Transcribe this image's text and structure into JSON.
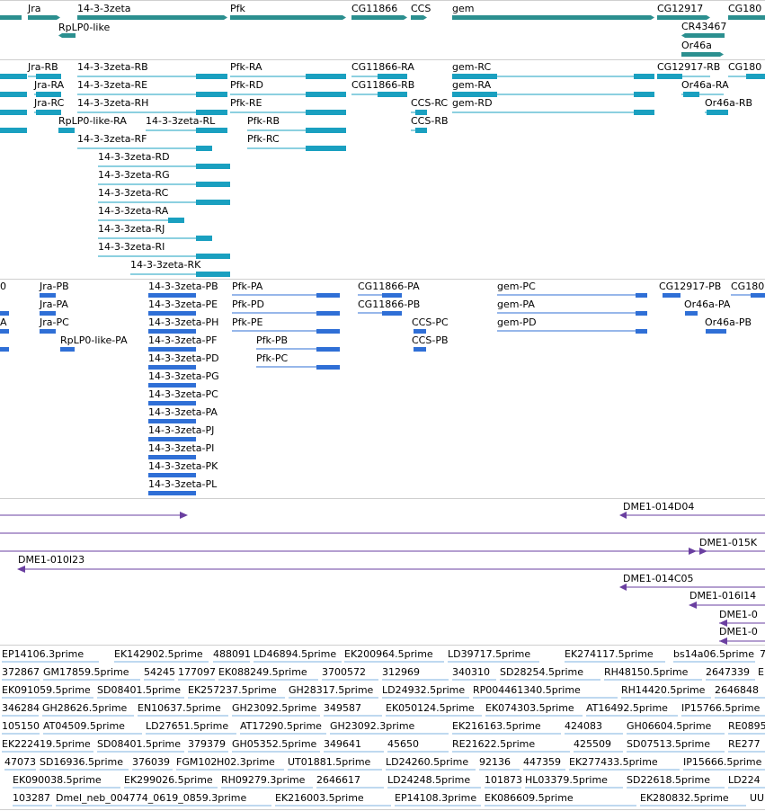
{
  "gene_track": {
    "color": "#2b8f8f",
    "labels": [
      "Jra",
      "14-3-3zeta",
      "Pfk",
      "CG11866",
      "CCS",
      "gem",
      "CG12917",
      "CG180",
      "RpLP0-like",
      "CR43467",
      "Or46a"
    ]
  },
  "transcript_track": {
    "color": "#1aa0c0",
    "labels": [
      "Jra-RB",
      "Jra-RA",
      "Jra-RC",
      "RpLP0-like-RA",
      "14-3-3zeta-RB",
      "14-3-3zeta-RE",
      "14-3-3zeta-RH",
      "14-3-3zeta-RL",
      "14-3-3zeta-RF",
      "14-3-3zeta-RD",
      "14-3-3zeta-RG",
      "14-3-3zeta-RC",
      "14-3-3zeta-RA",
      "14-3-3zeta-RJ",
      "14-3-3zeta-RI",
      "14-3-3zeta-RK",
      "Pfk-RA",
      "Pfk-RD",
      "Pfk-RE",
      "Pfk-RB",
      "Pfk-RC",
      "CG11866-RA",
      "CG11866-RB",
      "CCS-RC",
      "CCS-RB",
      "gem-RC",
      "gem-RA",
      "gem-RD",
      "CG12917-RB",
      "CG180",
      "Or46a-RA",
      "Or46a-RB"
    ]
  },
  "protein_track": {
    "color": "#2f6fd6",
    "labels": [
      "Jra-PB",
      "Jra-PA",
      "Jra-PC",
      "RpLP0-like-PA",
      "14-3-3zeta-PB",
      "14-3-3zeta-PE",
      "14-3-3zeta-PH",
      "14-3-3zeta-PF",
      "14-3-3zeta-PD",
      "14-3-3zeta-PG",
      "14-3-3zeta-PC",
      "14-3-3zeta-PA",
      "14-3-3zeta-PJ",
      "14-3-3zeta-PI",
      "14-3-3zeta-PK",
      "14-3-3zeta-PL",
      "Pfk-PA",
      "Pfk-PD",
      "Pfk-PE",
      "Pfk-PB",
      "Pfk-PC",
      "CG11866-PA",
      "CG11866-PB",
      "CCS-PC",
      "CCS-PB",
      "gem-PC",
      "gem-PA",
      "gem-PD",
      "CG12917-PB",
      "CG180",
      "Or46a-PA",
      "Or46a-PB"
    ],
    "stub_labels": [
      "0",
      "A"
    ]
  },
  "clone_track": {
    "color": "#6a3fa0",
    "labels": [
      "DME1-014D04",
      "DME1-015K",
      "DME1-010I23",
      "DME1-014C05",
      "DME1-016I14",
      "DME1-0",
      "DME1-0"
    ]
  },
  "read_track": {
    "color": "#7fb3e0",
    "rows": [
      [
        "EP14106.3prime",
        "EK142902.5prime",
        "488091",
        "LD46894.5prime",
        "EK200964.5prime",
        "LD39717.5prime",
        "EK274117.5prime",
        "bs14a06.5prime",
        "7"
      ],
      [
        "372867",
        "GM17859.5prime",
        "54245",
        "177097",
        "EK088249.5prime",
        "3700572",
        "312969",
        "340310",
        "SD28254.5prime",
        "RH48150.5prime",
        "2647339",
        "E"
      ],
      [
        "EK091059.5prime",
        "SD08401.5prime",
        "EK257237.5prime",
        "GH28317.5prime",
        "LD24932.5prime",
        "RP004461340.5prime",
        "RH14420.5prime",
        "2646848"
      ],
      [
        "346284",
        "GH28626.5prime",
        "EN10637.5prime",
        "GH23092.5prime",
        "349587",
        "EK050124.5prime",
        "EK074303.5prime",
        "AT16492.5prime",
        "IP15766.5prime"
      ],
      [
        "105150",
        "AT04509.5prime",
        "LD27651.5prime",
        "AT17290.5prime",
        "GH23092.3prime",
        "EK216163.5prime",
        "424083",
        "GH06604.5prime",
        "RE0895"
      ],
      [
        "EK222419.5prime",
        "SD08401.5prime",
        "379379",
        "GH05352.5prime",
        "349641",
        "45650",
        "RE21622.5prime",
        "425509",
        "SD07513.5prime",
        "RE277"
      ],
      [
        "47073",
        "SD16936.5prime",
        "376039",
        "FGM102",
        "H02.3prime",
        "UT01881.5prime",
        "LD24260.5prime",
        "92136",
        "447359",
        "EK277433.5prime",
        "IP15666.5prime"
      ],
      [
        "EK090038.5prime",
        "EK299026.5prime",
        "RH09279.3prime",
        "2646617",
        "LD24248.5prime",
        "101873",
        "HL03379.5prime",
        "SD22618.5prime",
        "LD224"
      ],
      [
        "103287",
        "Dmel_neb_004774_0619_0859.3prime",
        "EK216003.5prime",
        "EP14108.3prime",
        "EK086609.5prime",
        "EK280832.5prime",
        "UU"
      ]
    ]
  },
  "colors": {
    "track_divider": "#c8c8c8",
    "background": "#ffffff"
  }
}
